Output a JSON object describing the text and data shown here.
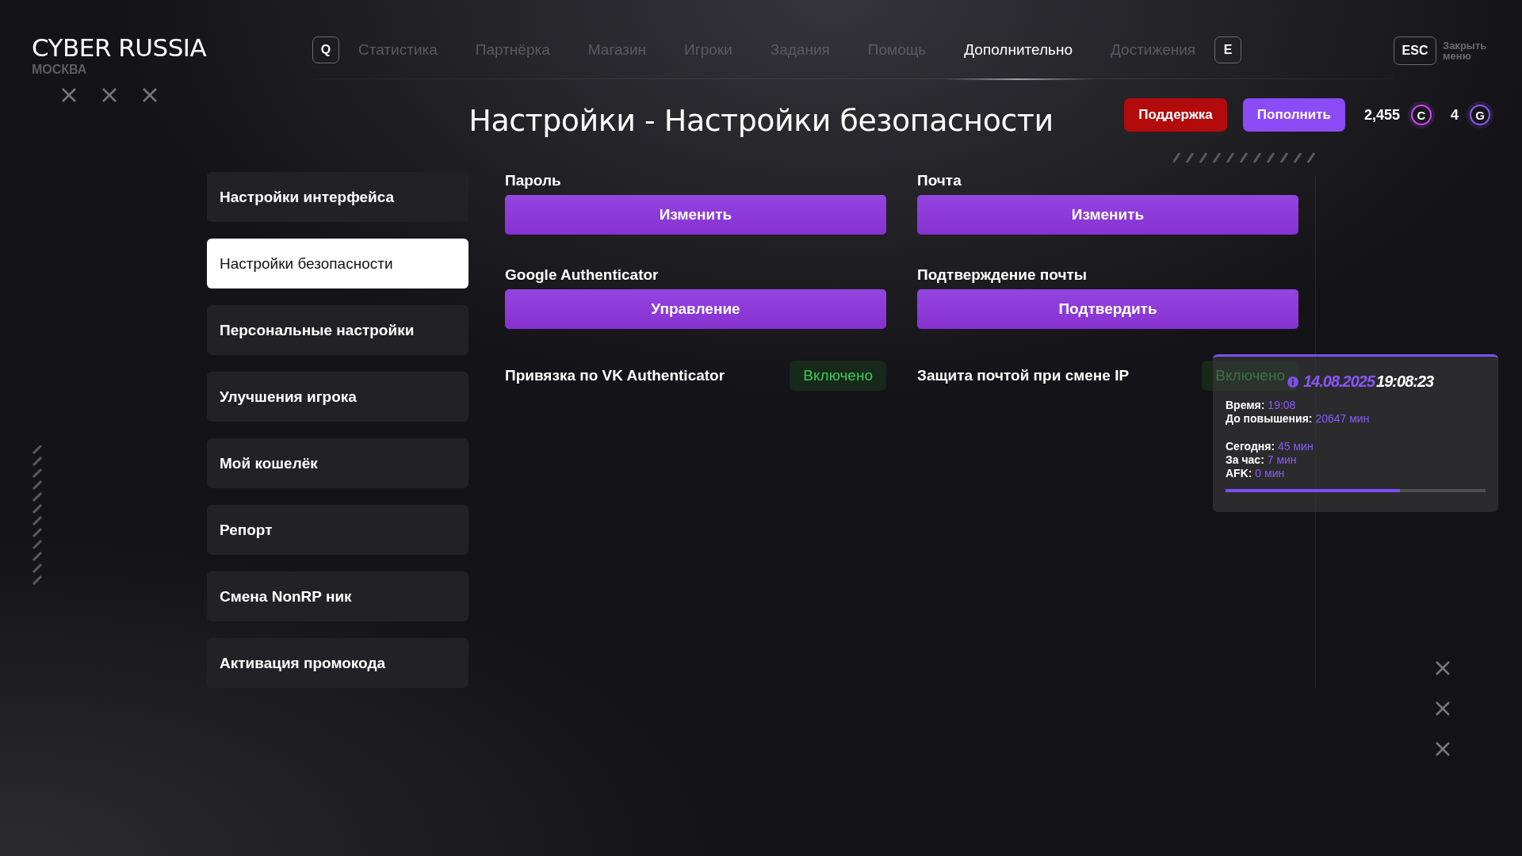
{
  "brand": {
    "title": "CYBER RUSSIA",
    "city": "МОСКВА"
  },
  "nav": {
    "prev_key": "Q",
    "next_key": "E",
    "items": [
      {
        "label": "Статистика",
        "selected": false
      },
      {
        "label": "Партнёрка",
        "selected": false
      },
      {
        "label": "Магазин",
        "selected": false
      },
      {
        "label": "Игроки",
        "selected": false
      },
      {
        "label": "Задания",
        "selected": false
      },
      {
        "label": "Помощь",
        "selected": false
      },
      {
        "label": "Дополнительно",
        "selected": true
      },
      {
        "label": "Достижения",
        "selected": false
      }
    ]
  },
  "close": {
    "key": "ESC",
    "label": "Закрыть меню"
  },
  "page_title": "Настройки - Настройки безопасности",
  "actions": [
    {
      "kind": "support",
      "label": "Поддержка"
    },
    {
      "kind": "topup",
      "label": "Пополнить"
    }
  ],
  "balances": [
    {
      "amount": "2,455",
      "symbol": "C",
      "color": "#e040fb"
    },
    {
      "amount": "4",
      "symbol": "G",
      "color": "#8b5cf6"
    }
  ],
  "sidebar": {
    "items": [
      {
        "label": "Настройки интерфейса",
        "selected": false
      },
      {
        "label": "Настройки безопасности",
        "selected": true
      },
      {
        "label": "Персональные настройки",
        "selected": false
      },
      {
        "label": "Улучшения игрока",
        "selected": false
      },
      {
        "label": "Мой кошелёк",
        "selected": false
      },
      {
        "label": "Репорт",
        "selected": false
      },
      {
        "label": "Смена NonRP ник",
        "selected": false
      },
      {
        "label": "Активация промокода",
        "selected": false
      }
    ]
  },
  "settings": [
    {
      "kind": "button",
      "label": "Пароль",
      "button": "Изменить"
    },
    {
      "kind": "button",
      "label": "Почта",
      "button": "Изменить"
    },
    {
      "kind": "button",
      "label": "Google Authenticator",
      "button": "Управление"
    },
    {
      "kind": "button",
      "label": "Подтверждение почты",
      "button": "Подтвердить"
    },
    {
      "kind": "toggle",
      "label": "Привязка по VK Authenticator",
      "status": "Включено",
      "on": true
    },
    {
      "kind": "toggle",
      "label": "Защита почтой при смене IP",
      "status": "Включено",
      "on": true
    }
  ],
  "tooltip": {
    "date": "14.08.2025",
    "time": "19:08:23",
    "level": 0.67,
    "groups": [
      {
        "lines": [
          {
            "label": "Время:",
            "value": "19:08"
          },
          {
            "label": "До повышения:",
            "value": "20647 мин"
          }
        ]
      },
      {
        "lines": [
          {
            "label": "Сегодня:",
            "value": "45 мин"
          },
          {
            "label": "За час:",
            "value": "7 мин"
          },
          {
            "label": "AFK:",
            "value": "0 мин"
          }
        ]
      }
    ]
  }
}
